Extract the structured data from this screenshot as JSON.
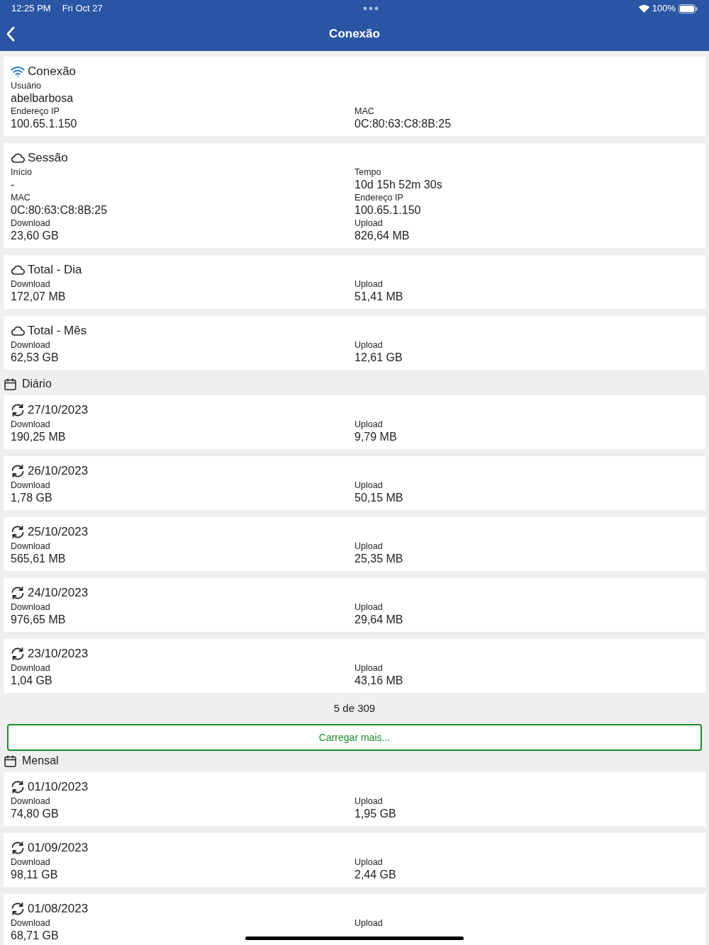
{
  "status_bar": {
    "time": "12:25 PM",
    "date": "Fri Oct 27",
    "battery": "100%"
  },
  "nav": {
    "title": "Conexão"
  },
  "cards": [
    {
      "kind": "wifi",
      "title": "Conexão",
      "rows": [
        [
          {
            "label": "Usuário",
            "value": "abelbarbosa"
          }
        ],
        [
          {
            "label": "Endereço IP",
            "value": "100.65.1.150"
          },
          {
            "label": "MAC",
            "value": "0C:80:63:C8:8B:25"
          }
        ]
      ]
    },
    {
      "kind": "cloud",
      "title": "Sessão",
      "rows": [
        [
          {
            "label": "Início",
            "value": "-"
          },
          {
            "label": "Tempo",
            "value": "10d 15h 52m 30s"
          }
        ],
        [
          {
            "label": "MAC",
            "value": "0C:80:63:C8:8B:25"
          },
          {
            "label": "Endereço IP",
            "value": "100.65.1.150"
          }
        ],
        [
          {
            "label": "Download",
            "value": "23,60 GB"
          },
          {
            "label": "Upload",
            "value": "826,64 MB"
          }
        ]
      ]
    },
    {
      "kind": "cloud",
      "title": "Total - Dia",
      "rows": [
        [
          {
            "label": "Download",
            "value": "172,07 MB"
          },
          {
            "label": "Upload",
            "value": "51,41 MB"
          }
        ]
      ]
    },
    {
      "kind": "cloud",
      "title": "Total - Mês",
      "rows": [
        [
          {
            "label": "Download",
            "value": "62,53 GB"
          },
          {
            "label": "Upload",
            "value": "12,61 GB"
          }
        ]
      ]
    }
  ],
  "daily": {
    "title": "Diário",
    "items": [
      {
        "kind": "sync",
        "title": "27/10/2023",
        "rows": [
          [
            {
              "label": "Download",
              "value": "190,25 MB"
            },
            {
              "label": "Upload",
              "value": "9,79 MB"
            }
          ]
        ]
      },
      {
        "kind": "sync",
        "title": "26/10/2023",
        "rows": [
          [
            {
              "label": "Download",
              "value": "1,78 GB"
            },
            {
              "label": "Upload",
              "value": "50,15 MB"
            }
          ]
        ]
      },
      {
        "kind": "sync",
        "title": "25/10/2023",
        "rows": [
          [
            {
              "label": "Download",
              "value": "565,61 MB"
            },
            {
              "label": "Upload",
              "value": "25,35 MB"
            }
          ]
        ]
      },
      {
        "kind": "sync",
        "title": "24/10/2023",
        "rows": [
          [
            {
              "label": "Download",
              "value": "976,65 MB"
            },
            {
              "label": "Upload",
              "value": "29,64 MB"
            }
          ]
        ]
      },
      {
        "kind": "sync",
        "title": "23/10/2023",
        "rows": [
          [
            {
              "label": "Download",
              "value": "1,04 GB"
            },
            {
              "label": "Upload",
              "value": "43,16 MB"
            }
          ]
        ]
      }
    ],
    "pager": "5 de 309",
    "button": "Carregar mais..."
  },
  "monthly": {
    "title": "Mensal",
    "items": [
      {
        "kind": "sync",
        "title": "01/10/2023",
        "rows": [
          [
            {
              "label": "Download",
              "value": "74,80 GB"
            },
            {
              "label": "Upload",
              "value": "1,95 GB"
            }
          ]
        ]
      },
      {
        "kind": "sync",
        "title": "01/09/2023",
        "rows": [
          [
            {
              "label": "Download",
              "value": "98,11 GB"
            },
            {
              "label": "Upload",
              "value": "2,44 GB"
            }
          ]
        ]
      },
      {
        "kind": "sync",
        "title": "01/08/2023",
        "rows": [
          [
            {
              "label": "Download",
              "value": "68,71 GB"
            },
            {
              "label": "Upload"
            }
          ]
        ]
      }
    ]
  }
}
